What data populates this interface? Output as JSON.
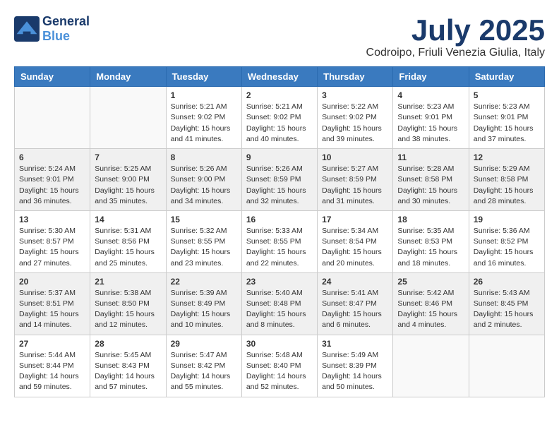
{
  "header": {
    "logo_general": "General",
    "logo_blue": "Blue",
    "month_title": "July 2025",
    "subtitle": "Codroipo, Friuli Venezia Giulia, Italy"
  },
  "days_of_week": [
    "Sunday",
    "Monday",
    "Tuesday",
    "Wednesday",
    "Thursday",
    "Friday",
    "Saturday"
  ],
  "weeks": [
    [
      {
        "day": "",
        "sunrise": "",
        "sunset": "",
        "daylight": ""
      },
      {
        "day": "",
        "sunrise": "",
        "sunset": "",
        "daylight": ""
      },
      {
        "day": "1",
        "sunrise": "Sunrise: 5:21 AM",
        "sunset": "Sunset: 9:02 PM",
        "daylight": "Daylight: 15 hours and 41 minutes."
      },
      {
        "day": "2",
        "sunrise": "Sunrise: 5:21 AM",
        "sunset": "Sunset: 9:02 PM",
        "daylight": "Daylight: 15 hours and 40 minutes."
      },
      {
        "day": "3",
        "sunrise": "Sunrise: 5:22 AM",
        "sunset": "Sunset: 9:02 PM",
        "daylight": "Daylight: 15 hours and 39 minutes."
      },
      {
        "day": "4",
        "sunrise": "Sunrise: 5:23 AM",
        "sunset": "Sunset: 9:01 PM",
        "daylight": "Daylight: 15 hours and 38 minutes."
      },
      {
        "day": "5",
        "sunrise": "Sunrise: 5:23 AM",
        "sunset": "Sunset: 9:01 PM",
        "daylight": "Daylight: 15 hours and 37 minutes."
      }
    ],
    [
      {
        "day": "6",
        "sunrise": "Sunrise: 5:24 AM",
        "sunset": "Sunset: 9:01 PM",
        "daylight": "Daylight: 15 hours and 36 minutes."
      },
      {
        "day": "7",
        "sunrise": "Sunrise: 5:25 AM",
        "sunset": "Sunset: 9:00 PM",
        "daylight": "Daylight: 15 hours and 35 minutes."
      },
      {
        "day": "8",
        "sunrise": "Sunrise: 5:26 AM",
        "sunset": "Sunset: 9:00 PM",
        "daylight": "Daylight: 15 hours and 34 minutes."
      },
      {
        "day": "9",
        "sunrise": "Sunrise: 5:26 AM",
        "sunset": "Sunset: 8:59 PM",
        "daylight": "Daylight: 15 hours and 32 minutes."
      },
      {
        "day": "10",
        "sunrise": "Sunrise: 5:27 AM",
        "sunset": "Sunset: 8:59 PM",
        "daylight": "Daylight: 15 hours and 31 minutes."
      },
      {
        "day": "11",
        "sunrise": "Sunrise: 5:28 AM",
        "sunset": "Sunset: 8:58 PM",
        "daylight": "Daylight: 15 hours and 30 minutes."
      },
      {
        "day": "12",
        "sunrise": "Sunrise: 5:29 AM",
        "sunset": "Sunset: 8:58 PM",
        "daylight": "Daylight: 15 hours and 28 minutes."
      }
    ],
    [
      {
        "day": "13",
        "sunrise": "Sunrise: 5:30 AM",
        "sunset": "Sunset: 8:57 PM",
        "daylight": "Daylight: 15 hours and 27 minutes."
      },
      {
        "day": "14",
        "sunrise": "Sunrise: 5:31 AM",
        "sunset": "Sunset: 8:56 PM",
        "daylight": "Daylight: 15 hours and 25 minutes."
      },
      {
        "day": "15",
        "sunrise": "Sunrise: 5:32 AM",
        "sunset": "Sunset: 8:55 PM",
        "daylight": "Daylight: 15 hours and 23 minutes."
      },
      {
        "day": "16",
        "sunrise": "Sunrise: 5:33 AM",
        "sunset": "Sunset: 8:55 PM",
        "daylight": "Daylight: 15 hours and 22 minutes."
      },
      {
        "day": "17",
        "sunrise": "Sunrise: 5:34 AM",
        "sunset": "Sunset: 8:54 PM",
        "daylight": "Daylight: 15 hours and 20 minutes."
      },
      {
        "day": "18",
        "sunrise": "Sunrise: 5:35 AM",
        "sunset": "Sunset: 8:53 PM",
        "daylight": "Daylight: 15 hours and 18 minutes."
      },
      {
        "day": "19",
        "sunrise": "Sunrise: 5:36 AM",
        "sunset": "Sunset: 8:52 PM",
        "daylight": "Daylight: 15 hours and 16 minutes."
      }
    ],
    [
      {
        "day": "20",
        "sunrise": "Sunrise: 5:37 AM",
        "sunset": "Sunset: 8:51 PM",
        "daylight": "Daylight: 15 hours and 14 minutes."
      },
      {
        "day": "21",
        "sunrise": "Sunrise: 5:38 AM",
        "sunset": "Sunset: 8:50 PM",
        "daylight": "Daylight: 15 hours and 12 minutes."
      },
      {
        "day": "22",
        "sunrise": "Sunrise: 5:39 AM",
        "sunset": "Sunset: 8:49 PM",
        "daylight": "Daylight: 15 hours and 10 minutes."
      },
      {
        "day": "23",
        "sunrise": "Sunrise: 5:40 AM",
        "sunset": "Sunset: 8:48 PM",
        "daylight": "Daylight: 15 hours and 8 minutes."
      },
      {
        "day": "24",
        "sunrise": "Sunrise: 5:41 AM",
        "sunset": "Sunset: 8:47 PM",
        "daylight": "Daylight: 15 hours and 6 minutes."
      },
      {
        "day": "25",
        "sunrise": "Sunrise: 5:42 AM",
        "sunset": "Sunset: 8:46 PM",
        "daylight": "Daylight: 15 hours and 4 minutes."
      },
      {
        "day": "26",
        "sunrise": "Sunrise: 5:43 AM",
        "sunset": "Sunset: 8:45 PM",
        "daylight": "Daylight: 15 hours and 2 minutes."
      }
    ],
    [
      {
        "day": "27",
        "sunrise": "Sunrise: 5:44 AM",
        "sunset": "Sunset: 8:44 PM",
        "daylight": "Daylight: 14 hours and 59 minutes."
      },
      {
        "day": "28",
        "sunrise": "Sunrise: 5:45 AM",
        "sunset": "Sunset: 8:43 PM",
        "daylight": "Daylight: 14 hours and 57 minutes."
      },
      {
        "day": "29",
        "sunrise": "Sunrise: 5:47 AM",
        "sunset": "Sunset: 8:42 PM",
        "daylight": "Daylight: 14 hours and 55 minutes."
      },
      {
        "day": "30",
        "sunrise": "Sunrise: 5:48 AM",
        "sunset": "Sunset: 8:40 PM",
        "daylight": "Daylight: 14 hours and 52 minutes."
      },
      {
        "day": "31",
        "sunrise": "Sunrise: 5:49 AM",
        "sunset": "Sunset: 8:39 PM",
        "daylight": "Daylight: 14 hours and 50 minutes."
      },
      {
        "day": "",
        "sunrise": "",
        "sunset": "",
        "daylight": ""
      },
      {
        "day": "",
        "sunrise": "",
        "sunset": "",
        "daylight": ""
      }
    ]
  ]
}
